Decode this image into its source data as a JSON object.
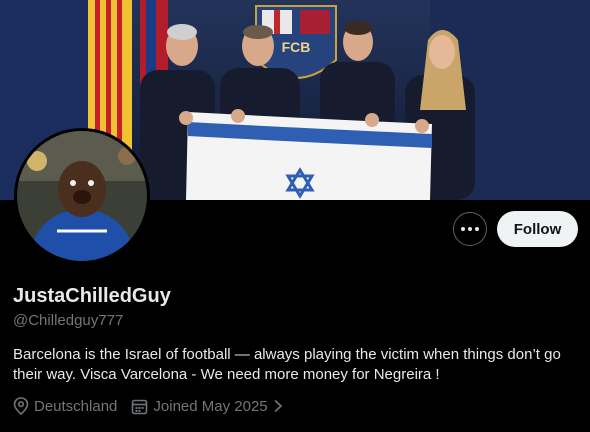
{
  "profile": {
    "display_name": "JustaChilledGuy",
    "handle": "@Chilledguy777",
    "bio": "Barcelona is the Israel of football — always playing the victim when things don’t go their way. Visca Varcelona - We need more money for Negreira !",
    "location": "Deutschland",
    "joined": "Joined May 2025"
  },
  "actions": {
    "follow_label": "Follow"
  },
  "banner": {
    "crest_text": "FCB"
  },
  "icons": {
    "more": "more-horizontal-icon",
    "location": "location-pin-icon",
    "calendar": "calendar-icon",
    "chevron": "chevron-right-icon"
  },
  "colors": {
    "background": "#000000",
    "text": "#e7e9ea",
    "muted": "#71767b",
    "follow_bg": "#eff3f4",
    "flag_blue": "#2f5fb3"
  }
}
